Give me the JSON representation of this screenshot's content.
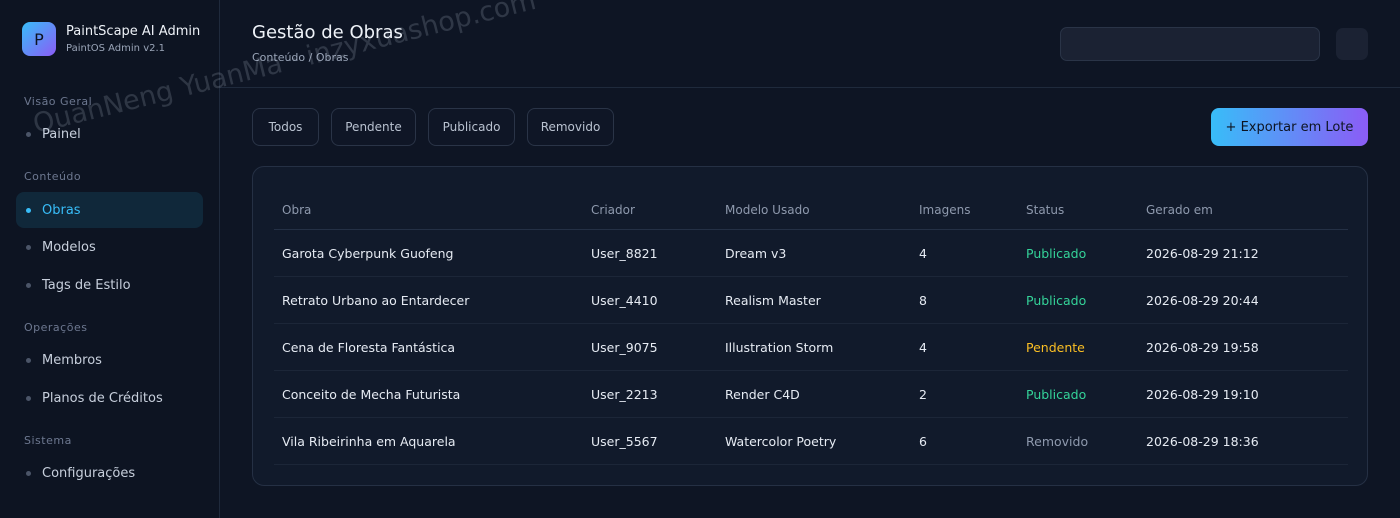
{
  "brand": {
    "logo": "P",
    "name": "PaintScape AI Admin",
    "version": "PaintOS Admin v2.1"
  },
  "sidebar": {
    "sections": [
      {
        "title": "Visão Geral",
        "items": [
          {
            "label": "Painel",
            "active": false
          }
        ]
      },
      {
        "title": "Conteúdo",
        "items": [
          {
            "label": "Obras",
            "active": true
          },
          {
            "label": "Modelos",
            "active": false
          },
          {
            "label": "Tags de Estilo",
            "active": false
          }
        ]
      },
      {
        "title": "Operações",
        "items": [
          {
            "label": "Membros",
            "active": false
          },
          {
            "label": "Planos de Créditos",
            "active": false
          }
        ]
      },
      {
        "title": "Sistema",
        "items": [
          {
            "label": "Configurações",
            "active": false
          }
        ]
      }
    ]
  },
  "header": {
    "title": "Gestão de Obras",
    "breadcrumb": "Conteúdo / Obras",
    "search_value": ""
  },
  "filters": [
    "Todos",
    "Pendente",
    "Publicado",
    "Removido"
  ],
  "export_label": "+ Exportar em Lote",
  "table": {
    "columns": [
      "Obra",
      "Criador",
      "Modelo Usado",
      "Imagens",
      "Status",
      "Gerado em"
    ],
    "rows": [
      [
        "Garota Cyberpunk Guofeng",
        "User_8821",
        "Dream v3",
        "4",
        "Publicado",
        "2026-08-29 21:12"
      ],
      [
        "Retrato Urbano ao Entardecer",
        "User_4410",
        "Realism Master",
        "8",
        "Publicado",
        "2026-08-29 20:44"
      ],
      [
        "Cena de Floresta Fantástica",
        "User_9075",
        "Illustration Storm",
        "4",
        "Pendente",
        "2026-08-29 19:58"
      ],
      [
        "Conceito de Mecha Futurista",
        "User_2213",
        "Render C4D",
        "2",
        "Publicado",
        "2026-08-29 19:10"
      ],
      [
        "Vila Ribeirinha em Aquarela",
        "User_5567",
        "Watercolor Poetry",
        "6",
        "Removido",
        "2026-08-29 18:36"
      ]
    ]
  },
  "status_colors": {
    "Publicado": "#34d399",
    "Pendente": "#fbbf24",
    "Removido": "#8e99ad"
  },
  "accent_color": "#38bdf8",
  "watermark": "QuanNeng YuanMa · inzyxuashop.com"
}
